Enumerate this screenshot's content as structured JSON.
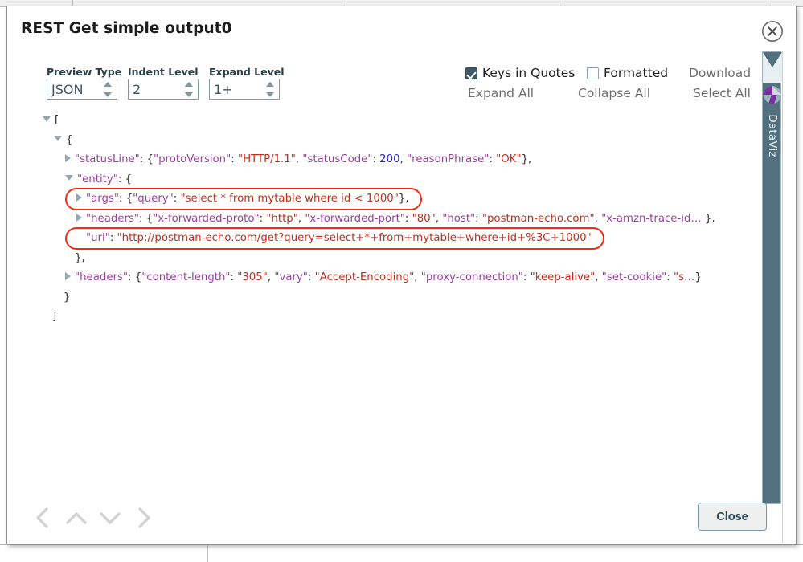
{
  "dialog": {
    "title": "REST Get simple output0",
    "close_icon": "close-circle-icon"
  },
  "controls": {
    "preview_type": {
      "label": "Preview Type",
      "value": "JSON"
    },
    "indent_level": {
      "label": "Indent Level",
      "value": "2"
    },
    "expand_level": {
      "label": "Expand Level",
      "value": "1+"
    },
    "keys_in_quotes": {
      "label": "Keys in Quotes",
      "checked": true
    },
    "formatted": {
      "label": "Formatted",
      "checked": false
    },
    "download_label": "Download",
    "expand_all_label": "Expand All",
    "collapse_all_label": "Collapse All",
    "select_all_label": "Select All"
  },
  "json_tree": {
    "rows": [
      {
        "indent": 0,
        "toggle": "open",
        "parts": [
          {
            "t": "[",
            "c": "p"
          }
        ]
      },
      {
        "indent": 1,
        "toggle": "open",
        "parts": [
          {
            "t": "{",
            "c": "p"
          }
        ]
      },
      {
        "indent": 2,
        "toggle": "closed",
        "parts": [
          {
            "t": "\"statusLine\"",
            "c": "k"
          },
          {
            "t": ": ",
            "c": "p"
          },
          {
            "t": "{",
            "c": "p"
          },
          {
            "t": "\"protoVersion\"",
            "c": "k"
          },
          {
            "t": ":  ",
            "c": "p"
          },
          {
            "t": "\"HTTP/1.1\"",
            "c": "s"
          },
          {
            "t": ", ",
            "c": "p"
          },
          {
            "t": "\"statusCode\"",
            "c": "k"
          },
          {
            "t": ":  ",
            "c": "p"
          },
          {
            "t": "200",
            "c": "n"
          },
          {
            "t": ", ",
            "c": "p"
          },
          {
            "t": "\"reasonPhrase\"",
            "c": "k"
          },
          {
            "t": ":  ",
            "c": "p"
          },
          {
            "t": "\"OK\"",
            "c": "s"
          },
          {
            "t": "},",
            "c": "p"
          }
        ]
      },
      {
        "indent": 2,
        "toggle": "open",
        "parts": [
          {
            "t": "\"entity\"",
            "c": "k"
          },
          {
            "t": ": {",
            "c": "p"
          }
        ]
      },
      {
        "indent": 3,
        "toggle": "closed",
        "annotated": true,
        "parts": [
          {
            "t": "\"args\"",
            "c": "k"
          },
          {
            "t": ": {",
            "c": "p"
          },
          {
            "t": "\"query\"",
            "c": "k"
          },
          {
            "t": ":  ",
            "c": "p"
          },
          {
            "t": "\"select * from mytable where id < 1000\"",
            "c": "s"
          },
          {
            "t": "},",
            "c": "p"
          }
        ]
      },
      {
        "indent": 3,
        "toggle": "closed",
        "parts": [
          {
            "t": "\"headers\"",
            "c": "k"
          },
          {
            "t": ": {",
            "c": "p"
          },
          {
            "t": "\"x-forwarded-proto\"",
            "c": "k"
          },
          {
            "t": ":  ",
            "c": "p"
          },
          {
            "t": "\"http\"",
            "c": "s"
          },
          {
            "t": ", ",
            "c": "p"
          },
          {
            "t": "\"x-forwarded-port\"",
            "c": "k"
          },
          {
            "t": ":  ",
            "c": "p"
          },
          {
            "t": "\"80\"",
            "c": "s"
          },
          {
            "t": ", ",
            "c": "p"
          },
          {
            "t": "\"host\"",
            "c": "k"
          },
          {
            "t": ":  ",
            "c": "p"
          },
          {
            "t": "\"postman-echo.com\"",
            "c": "s"
          },
          {
            "t": ", ",
            "c": "p"
          },
          {
            "t": "\"x-amzn-trace-id",
            "c": "k"
          },
          {
            "t": "…",
            "c": "dots"
          },
          {
            "t": " },",
            "c": "p"
          }
        ]
      },
      {
        "indent": 3,
        "toggle": "none",
        "annotated": true,
        "parts": [
          {
            "t": "\"url\"",
            "c": "k"
          },
          {
            "t": ":  ",
            "c": "p"
          },
          {
            "t": "\"http://postman-echo.com/get?query=select+*+from+mytable+where+id+%3C+1000\"",
            "c": "s"
          }
        ]
      },
      {
        "indent": 2,
        "toggle": "none",
        "parts": [
          {
            "t": "},",
            "c": "p"
          }
        ]
      },
      {
        "indent": 2,
        "toggle": "closed",
        "parts": [
          {
            "t": "\"headers\"",
            "c": "k"
          },
          {
            "t": ": {",
            "c": "p"
          },
          {
            "t": "\"content-length\"",
            "c": "k"
          },
          {
            "t": ":  ",
            "c": "p"
          },
          {
            "t": "\"305\"",
            "c": "s"
          },
          {
            "t": ", ",
            "c": "p"
          },
          {
            "t": "\"vary\"",
            "c": "k"
          },
          {
            "t": ":  ",
            "c": "p"
          },
          {
            "t": "\"Accept-Encoding\"",
            "c": "s"
          },
          {
            "t": ", ",
            "c": "p"
          },
          {
            "t": "\"proxy-connection\"",
            "c": "k"
          },
          {
            "t": ":  ",
            "c": "p"
          },
          {
            "t": "\"keep-alive\"",
            "c": "s"
          },
          {
            "t": ", ",
            "c": "p"
          },
          {
            "t": "\"set-cookie\"",
            "c": "k"
          },
          {
            "t": ":  ",
            "c": "p"
          },
          {
            "t": "\"s",
            "c": "s"
          },
          {
            "t": "…",
            "c": "dots"
          },
          {
            "t": "}",
            "c": "p"
          }
        ]
      },
      {
        "indent": 1,
        "toggle": "none",
        "parts": [
          {
            "t": "}",
            "c": "p"
          }
        ]
      },
      {
        "indent": 0,
        "toggle": "none",
        "parts": [
          {
            "t": "]",
            "c": "p"
          }
        ]
      }
    ]
  },
  "side_tab": {
    "label": "DataViz",
    "icon": "pie-chart-icon",
    "color": "#52707e"
  },
  "footer": {
    "nav": [
      {
        "name": "prev-arrow",
        "icon": "chevron-left-icon"
      },
      {
        "name": "up-arrow",
        "icon": "chevron-up-icon"
      },
      {
        "name": "down-arrow",
        "icon": "chevron-down-icon"
      },
      {
        "name": "next-arrow",
        "icon": "chevron-right-icon"
      }
    ],
    "close_label": "Close"
  },
  "colors": {
    "key": "#9b3fa0",
    "string": "#c62c1d",
    "number": "#2222dd",
    "annotation": "#f52a10",
    "accent": "#52707e"
  }
}
